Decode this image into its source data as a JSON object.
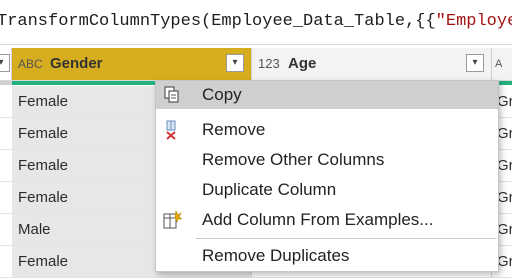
{
  "formula": {
    "prefix": "TransformColumnTypes(Employee_Data_Table,{{",
    "string_part": "\"EmployeeI"
  },
  "columns": [
    {
      "type_icon": "ABC",
      "label": "Gender",
      "selected": true
    },
    {
      "type_icon": "123",
      "label": "Age",
      "selected": false
    }
  ],
  "rows": [
    {
      "gender": "Female",
      "right": "Gr"
    },
    {
      "gender": "Female",
      "right": "Gr"
    },
    {
      "gender": "Female",
      "right": "Gr"
    },
    {
      "gender": "Female",
      "right": "Gr"
    },
    {
      "gender": "Male",
      "right": "Gr"
    },
    {
      "gender": "Female",
      "right": "Gr"
    }
  ],
  "menu": {
    "items": [
      {
        "label": "Copy",
        "icon": "copy-icon",
        "hover": true
      },
      {
        "label": "Remove",
        "icon": "remove-column-icon"
      },
      {
        "label": "Remove Other Columns",
        "icon": ""
      },
      {
        "label": "Duplicate Column",
        "icon": ""
      },
      {
        "label": "Add Column From Examples...",
        "icon": "add-column-examples-icon"
      },
      {
        "label": "Remove Duplicates",
        "icon": ""
      }
    ]
  },
  "colors": {
    "selected_header": "#d6ad1e",
    "quality_bar": "#22b37c",
    "menu_hover": "#cfcfcf"
  }
}
